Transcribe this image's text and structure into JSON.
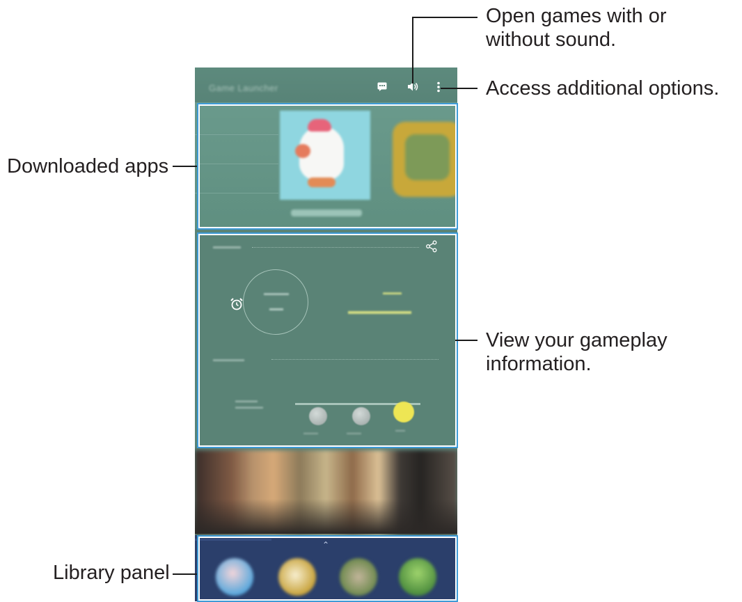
{
  "app": {
    "title": "Game Launcher",
    "appbar": {
      "chat_icon": "chat-icon",
      "sound_icon": "sound-icon",
      "more_icon": "more-vert-icon"
    }
  },
  "callouts": {
    "sound": "Open games with or without sound.",
    "more": "Access additional options.",
    "downloaded": "Downloaded apps",
    "gameplay": "View your gameplay information.",
    "library": "Library panel"
  },
  "colors": {
    "callout_blue": "#3d9ad6",
    "screen_teal": "#5b8378",
    "library_navy": "#2b3f6b"
  }
}
